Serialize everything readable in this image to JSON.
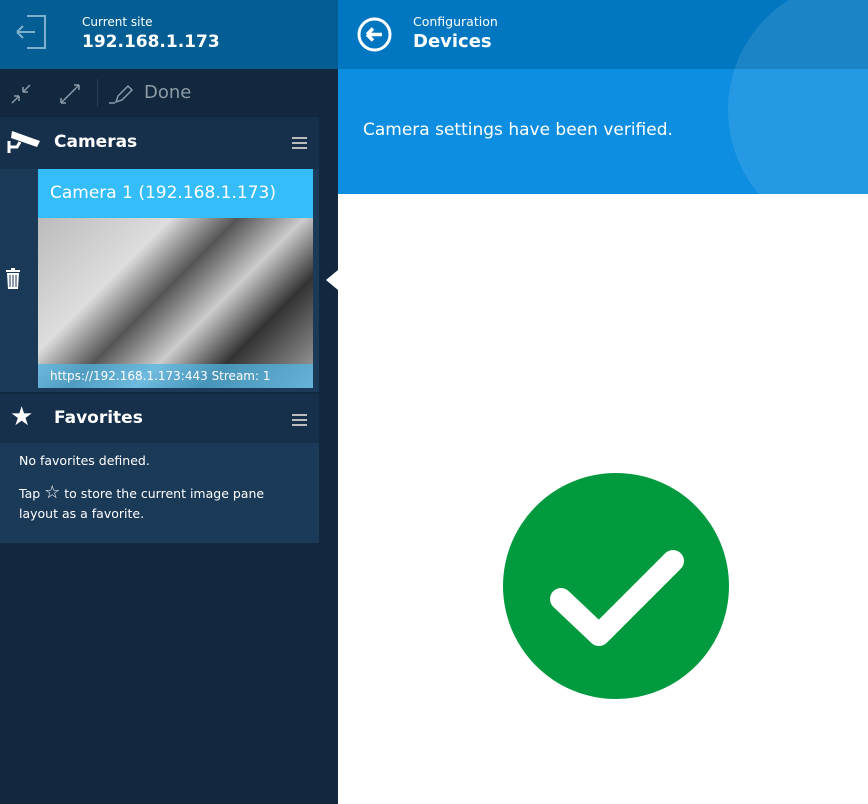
{
  "site": {
    "label": "Current site",
    "value": "192.168.1.173"
  },
  "toolbar": {
    "done_label": "Done"
  },
  "cameras": {
    "title": "Cameras",
    "items": [
      {
        "name": "Camera 1 (192.168.1.173)",
        "url": "https://192.168.1.173:443 Stream: 1"
      }
    ]
  },
  "favorites": {
    "title": "Favorites",
    "empty": "No favorites defined.",
    "hint_pre": "Tap",
    "hint_post": "to store the current image pane layout as a favorite."
  },
  "header": {
    "breadcrumb": "Configuration",
    "title": "Devices"
  },
  "message": "Camera settings have been verified.",
  "colors": {
    "success": "#029a3e",
    "accent": "#34bdf8"
  }
}
